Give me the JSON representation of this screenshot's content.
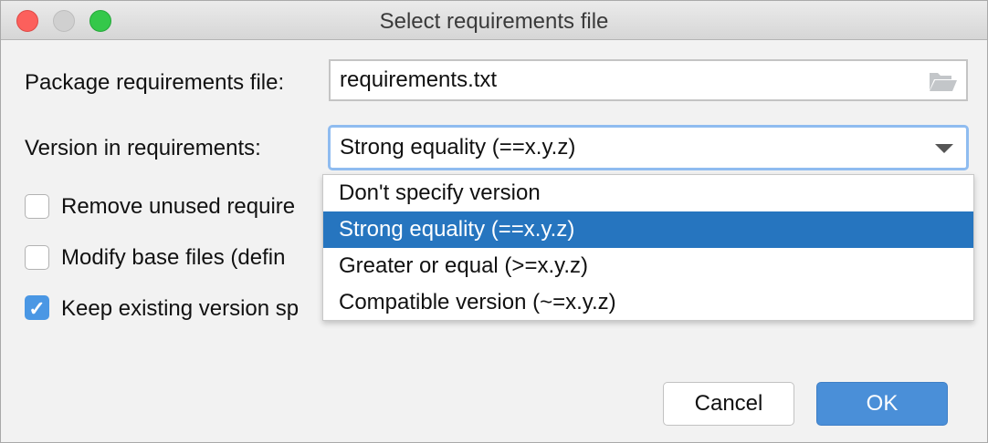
{
  "window": {
    "title": "Select requirements file"
  },
  "form": {
    "file_label": "Package requirements file:",
    "file_value": "requirements.txt",
    "version_label": "Version in requirements:",
    "version_value": "Strong equality (==x.y.z)"
  },
  "checkboxes": [
    {
      "label": "Remove unused require",
      "checked": false
    },
    {
      "label": "Modify base files (defin",
      "checked": false
    },
    {
      "label": "Keep existing version sp",
      "checked": true
    }
  ],
  "dropdown": {
    "options": [
      "Don't specify version",
      "Strong equality (==x.y.z)",
      "Greater or equal (>=x.y.z)",
      "Compatible version (~=x.y.z)"
    ],
    "selected_index": 1
  },
  "buttons": {
    "cancel": "Cancel",
    "ok": "OK"
  },
  "colors": {
    "accent": "#2675bf",
    "ok_button": "#4a8fd8"
  }
}
